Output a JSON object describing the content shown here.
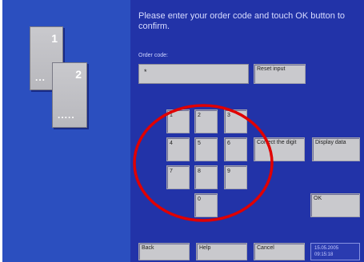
{
  "window": {
    "background": "#2233a8",
    "side_background": "#2b4fbf"
  },
  "side": {
    "card1_number": "1",
    "card1_dots": "...",
    "card2_number": "2",
    "card2_dots": "....."
  },
  "instruction": "Please enter your order code and touch OK button to confirm.",
  "order": {
    "label": "Order code:",
    "value": "*"
  },
  "buttons": {
    "reset": "Reset input",
    "correct": "Correct the digit",
    "display": "Display data",
    "ok": "OK",
    "back": "Back",
    "help": "Help",
    "cancel": "Cancel"
  },
  "keypad": [
    "1",
    "2",
    "3",
    "4",
    "5",
    "6",
    "7",
    "8",
    "9",
    "0"
  ],
  "clock": {
    "date": "15.05.2005",
    "time": "09:15:18"
  },
  "annotation": {
    "color": "#e00000"
  }
}
